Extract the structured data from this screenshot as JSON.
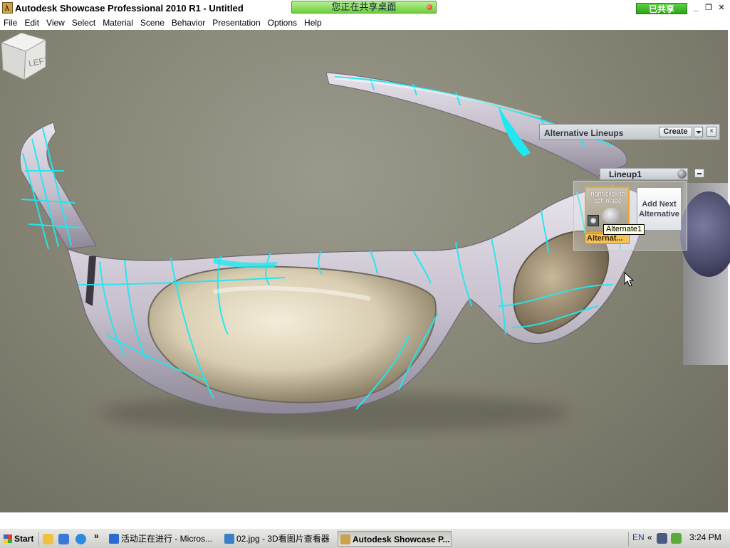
{
  "window": {
    "title": "Autodesk Showcase Professional 2010 R1 - Untitled",
    "share_banner": "您正在共享桌面",
    "shared_badge": "已共享",
    "min": "_",
    "restore": "❐",
    "close": "✕"
  },
  "menu": [
    "File",
    "Edit",
    "View",
    "Select",
    "Material",
    "Scene",
    "Behavior",
    "Presentation",
    "Options",
    "Help"
  ],
  "viewcube": {
    "face_label": "LEFT"
  },
  "lineups_panel": {
    "title": "Alternative Lineups",
    "create_label": "Create",
    "close_label": "×",
    "lineup_name": "Lineup1",
    "alternative": {
      "hint": "right-click to set image",
      "label": "Alternat...",
      "tooltip": "Alternate1"
    },
    "add_next_label": "Add Next Alternative"
  },
  "taskbar": {
    "start_label": "Start",
    "chevron": "»",
    "tasks": [
      {
        "label": "活动正在进行 - Micros...",
        "color": "#2a6bd1"
      },
      {
        "label": "02.jpg - 3D看图片查看器",
        "color": "#3d7fc7"
      },
      {
        "label": "Autodesk Showcase P...",
        "color": "#c9a24a"
      }
    ],
    "lang": "EN",
    "tray_chevron": "«",
    "clock": "3:24 PM"
  }
}
